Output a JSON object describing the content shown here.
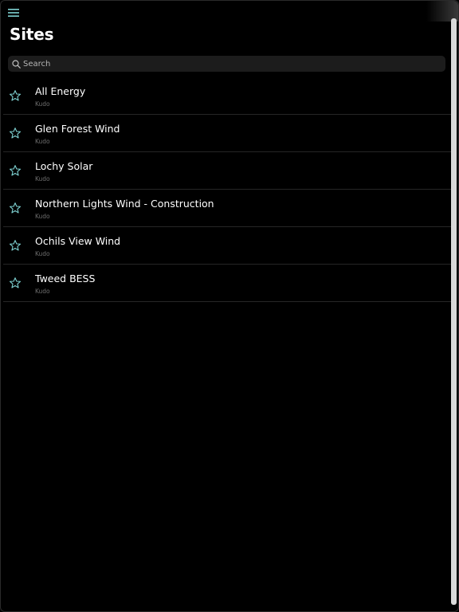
{
  "header": {
    "title": "Sites",
    "menu_icon": "hamburger-menu-icon"
  },
  "search": {
    "placeholder": "Search",
    "value": "",
    "icon": "search-icon"
  },
  "colors": {
    "accent": "#7fd3d3",
    "background": "#000000",
    "row_divider": "#262626",
    "subtitle": "#6e6e6e"
  },
  "sites": [
    {
      "name": "All Energy",
      "org": "Kudo",
      "favorite": false
    },
    {
      "name": "Glen Forest Wind",
      "org": "Kudo",
      "favorite": false
    },
    {
      "name": "Lochy Solar",
      "org": "Kudo",
      "favorite": false
    },
    {
      "name": "Northern Lights Wind - Construction",
      "org": "Kudo",
      "favorite": false
    },
    {
      "name": "Ochils View Wind",
      "org": "Kudo",
      "favorite": false
    },
    {
      "name": "Tweed BESS",
      "org": "Kudo",
      "favorite": false
    }
  ]
}
